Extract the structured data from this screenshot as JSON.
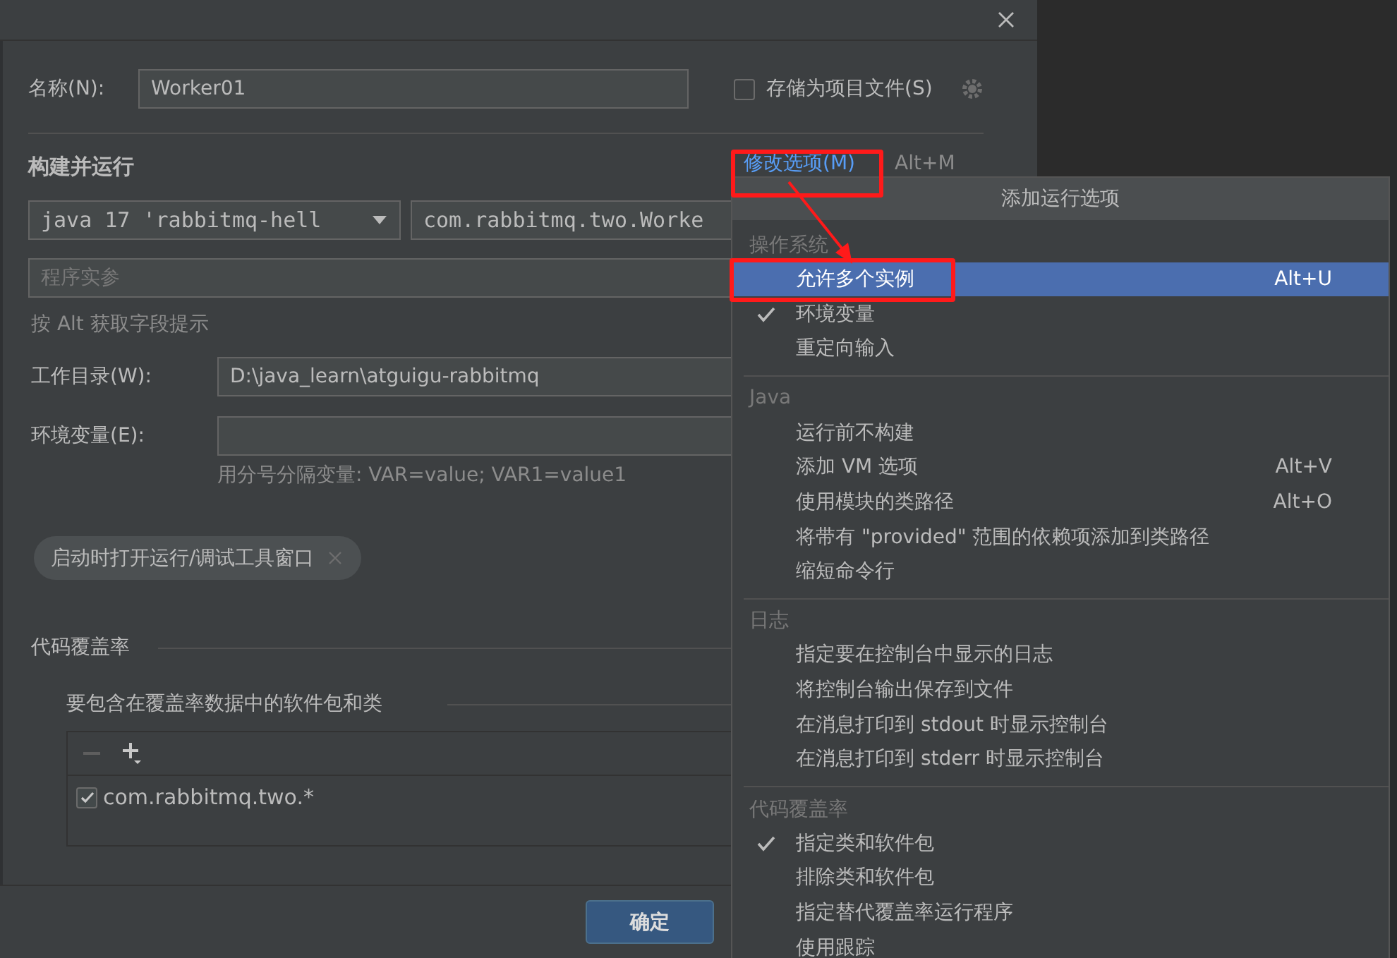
{
  "dialog": {
    "name_label": "名称(N):",
    "name_value": "Worker01",
    "store_as_file": {
      "label": "存储为项目文件(S)",
      "checked": false
    },
    "section_title": "构建并运行",
    "modify_options": {
      "label": "修改选项(M)",
      "shortcut": "Alt+M"
    },
    "jdk_select": "java 17 'rabbitmq-hell",
    "main_class": "com.rabbitmq.two.Worke",
    "args_placeholder": "程序实参",
    "alt_hint": "按 Alt 获取字段提示",
    "workdir": {
      "label": "工作目录(W):",
      "value": "D:\\java_learn\\atguigu-rabbitmq"
    },
    "env": {
      "label": "环境变量(E):",
      "hint": "用分号分隔变量: VAR=value; VAR1=value1"
    },
    "chip": "启动时打开运行/调试工具窗口",
    "coverage": {
      "title": "代码覆盖率",
      "subtitle": "要包含在覆盖率数据中的软件包和类",
      "rows": [
        {
          "label": "com.rabbitmq.two.*",
          "checked": true
        }
      ]
    },
    "ok_button": "确定"
  },
  "popup": {
    "title": "添加运行选项",
    "sections": [
      {
        "title": "操作系统",
        "items": [
          {
            "label": "允许多个实例",
            "shortcut": "Alt+U",
            "checked": false,
            "selected": true
          },
          {
            "label": "环境变量",
            "checked": true,
            "selected": false
          },
          {
            "label": "重定向输入",
            "checked": false,
            "selected": false
          }
        ]
      },
      {
        "title": "Java",
        "items": [
          {
            "label": "运行前不构建",
            "checked": false,
            "selected": false
          },
          {
            "label": "添加 VM 选项",
            "shortcut": "Alt+V",
            "checked": false,
            "selected": false
          },
          {
            "label": "使用模块的类路径",
            "shortcut": "Alt+O",
            "checked": false,
            "selected": false
          },
          {
            "label": "将带有 \"provided\" 范围的依赖项添加到类路径",
            "checked": false,
            "selected": false
          },
          {
            "label": "缩短命令行",
            "checked": false,
            "selected": false
          }
        ]
      },
      {
        "title": "日志",
        "items": [
          {
            "label": "指定要在控制台中显示的日志",
            "checked": false,
            "selected": false
          },
          {
            "label": "将控制台输出保存到文件",
            "checked": false,
            "selected": false
          },
          {
            "label": "在消息打印到 stdout 时显示控制台",
            "checked": false,
            "selected": false
          },
          {
            "label": "在消息打印到 stderr 时显示控制台",
            "checked": false,
            "selected": false
          }
        ]
      },
      {
        "title": "代码覆盖率",
        "items": [
          {
            "label": "指定类和软件包",
            "checked": true,
            "selected": false
          },
          {
            "label": "排除类和软件包",
            "checked": false,
            "selected": false
          },
          {
            "label": "指定替代覆盖率运行程序",
            "checked": false,
            "selected": false
          },
          {
            "label": "使用跟踪",
            "checked": false,
            "selected": false
          }
        ]
      }
    ]
  }
}
